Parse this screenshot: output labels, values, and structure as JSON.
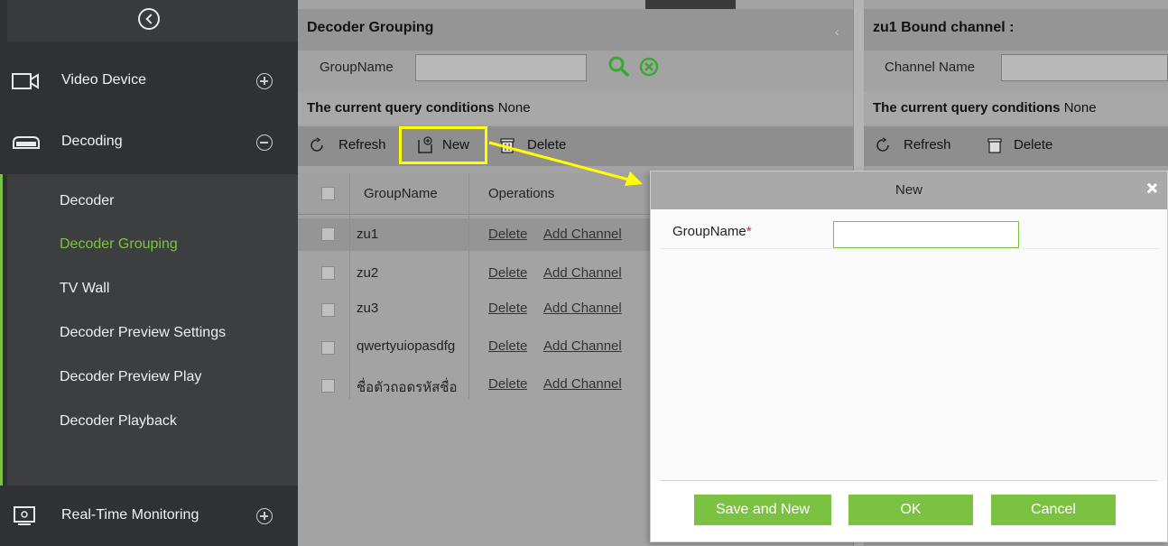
{
  "sidebar": {
    "modules": [
      {
        "label": "Video Device",
        "icon": "camera-icon",
        "state": "collapsed"
      },
      {
        "label": "Decoding",
        "icon": "decoder-icon",
        "state": "expanded"
      },
      {
        "label": "Real-Time Monitoring",
        "icon": "monitor-icon",
        "state": "collapsed"
      }
    ],
    "decoding_items": [
      {
        "label": "Decoder",
        "active": false
      },
      {
        "label": "Decoder Grouping",
        "active": true
      },
      {
        "label": "TV Wall",
        "active": false
      },
      {
        "label": "Decoder Preview Settings",
        "active": false
      },
      {
        "label": "Decoder Preview Play",
        "active": false
      },
      {
        "label": "Decoder Playback",
        "active": false
      }
    ]
  },
  "left_panel": {
    "title": "Decoder Grouping",
    "search_label": "GroupName",
    "query_label": "The current query conditions",
    "query_value": "None",
    "toolbar": {
      "refresh": "Refresh",
      "new": "New",
      "delete": "Delete"
    },
    "columns": [
      "GroupName",
      "Operations"
    ],
    "rows": [
      {
        "name": "zu1",
        "op_delete": "Delete",
        "op_add": "Add Channel",
        "selected": true
      },
      {
        "name": "zu2",
        "op_delete": "Delete",
        "op_add": "Add Channel",
        "selected": false
      },
      {
        "name": "zu3",
        "op_delete": "Delete",
        "op_add": "Add Channel",
        "selected": false
      },
      {
        "name": "qwertyuiopasdfg",
        "op_delete": "Delete",
        "op_add": "Add Channel",
        "selected": false
      },
      {
        "name": "ชื่อตัวถอดรหัสชื่อ",
        "op_delete": "Delete",
        "op_add": "Add Channel",
        "selected": false
      }
    ]
  },
  "right_panel": {
    "title": "zu1 Bound channel :",
    "search_label": "Channel Name",
    "query_label": "The current query conditions",
    "query_value": "None",
    "toolbar": {
      "refresh": "Refresh",
      "delete": "Delete"
    }
  },
  "dialog": {
    "title": "New",
    "field_label": "GroupName",
    "required_mark": "*",
    "field_value": "",
    "buttons": {
      "save_new": "Save and New",
      "ok": "OK",
      "cancel": "Cancel"
    }
  },
  "colors": {
    "accent": "#7cc242",
    "highlight": "#ffff00",
    "sidebar_bg": "#2f3132"
  }
}
